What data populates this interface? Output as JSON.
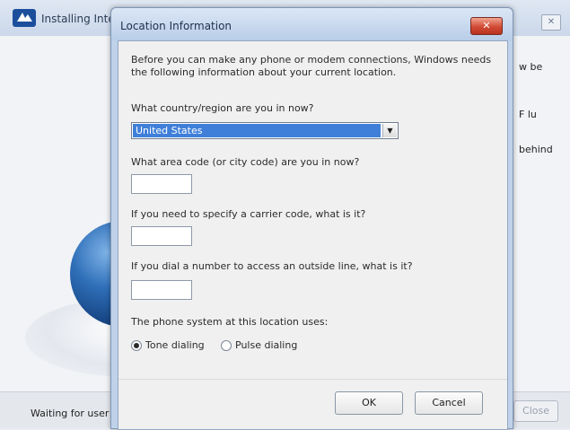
{
  "background_window": {
    "title": "Installing Inte",
    "close_glyph": "✕",
    "right_text": [
      "w be",
      "F lu",
      "behind"
    ],
    "status": "Waiting for user i",
    "button_label": "Close"
  },
  "dialog": {
    "title": "Location Information",
    "close_glyph": "✕",
    "intro_line1": "Before you can make any phone or modem connections, Windows needs",
    "intro_line2": "the following information about your current location.",
    "country": {
      "label": "What country/region are you in now?",
      "selected": "United States"
    },
    "area_code": {
      "label": "What area code (or city code) are you in now?",
      "value": ""
    },
    "carrier_code": {
      "label": "If you need to specify a carrier code, what is it?",
      "value": ""
    },
    "outside_line": {
      "label": "If you dial a number to access an outside line, what is it?",
      "value": ""
    },
    "phone_system": {
      "label": "The phone system at this location uses:",
      "options": [
        {
          "label": "Tone dialing",
          "selected": true
        },
        {
          "label": "Pulse dialing",
          "selected": false
        }
      ]
    },
    "ok_label": "OK",
    "cancel_label": "Cancel"
  },
  "colors": {
    "selection": "#3f7fd9",
    "close_button": "#d14a35",
    "dialog_frame": "#bfd2ea"
  }
}
